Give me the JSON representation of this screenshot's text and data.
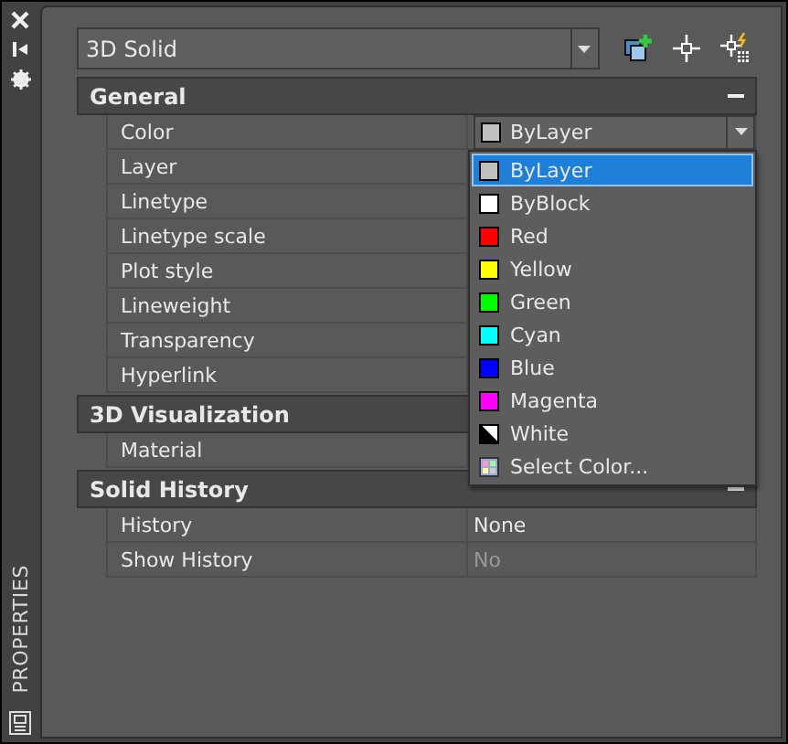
{
  "side_strip": {
    "title": "PROPERTIES"
  },
  "object_selector": {
    "value": "3D Solid"
  },
  "sections": [
    {
      "title": "General",
      "expanded": true,
      "rows": [
        {
          "label": "Color",
          "value": "ByLayer",
          "kind": "color-select",
          "open": true
        },
        {
          "label": "Layer"
        },
        {
          "label": "Linetype"
        },
        {
          "label": "Linetype scale"
        },
        {
          "label": "Plot style"
        },
        {
          "label": "Lineweight"
        },
        {
          "label": "Transparency"
        },
        {
          "label": "Hyperlink"
        }
      ]
    },
    {
      "title": "3D Visualization",
      "expanded": true,
      "rows": [
        {
          "label": "Material"
        }
      ]
    },
    {
      "title": "Solid History",
      "expanded": true,
      "rows": [
        {
          "label": "History",
          "value": "None",
          "disabled": false
        },
        {
          "label": "Show History",
          "value": "No",
          "disabled": true
        }
      ]
    }
  ],
  "color_menu": [
    {
      "label": "ByLayer",
      "kind": "swatch",
      "color": "#c0c0c0",
      "selected": true
    },
    {
      "label": "ByBlock",
      "kind": "swatch",
      "color": "#ffffff",
      "selected": false
    },
    {
      "label": "Red",
      "kind": "swatch",
      "color": "#ff0000",
      "selected": false
    },
    {
      "label": "Yellow",
      "kind": "swatch",
      "color": "#ffff00",
      "selected": false
    },
    {
      "label": "Green",
      "kind": "swatch",
      "color": "#00ff00",
      "selected": false
    },
    {
      "label": "Cyan",
      "kind": "swatch",
      "color": "#00ffff",
      "selected": false
    },
    {
      "label": "Blue",
      "kind": "swatch",
      "color": "#0000ff",
      "selected": false
    },
    {
      "label": "Magenta",
      "kind": "swatch",
      "color": "#ff00ff",
      "selected": false
    },
    {
      "label": "White",
      "kind": "split",
      "selected": false
    },
    {
      "label": "Select Color...",
      "kind": "picker",
      "selected": false
    }
  ]
}
